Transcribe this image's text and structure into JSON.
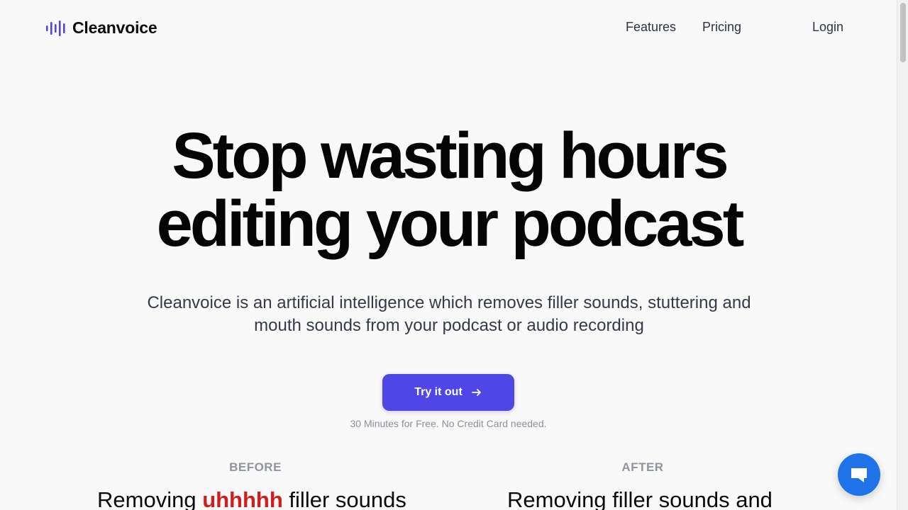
{
  "header": {
    "logo_text": "Cleanvoice",
    "nav": {
      "features": "Features",
      "pricing": "Pricing",
      "login": "Login"
    }
  },
  "hero": {
    "headline_line1": "Stop wasting hours",
    "headline_line2": "editing your podcast",
    "subtext": "Cleanvoice is an artificial intelligence which removes filler sounds, stuttering and mouth sounds from your podcast or audio recording",
    "cta_label": "Try it out",
    "cta_note": "30 Minutes for Free. No Credit Card needed."
  },
  "comparison": {
    "before_label": "BEFORE",
    "before_prefix": "Removing ",
    "before_filler": "uhhhhh",
    "before_suffix": " filler sounds",
    "after_label": "AFTER",
    "after_text": "Removing filler sounds and"
  },
  "colors": {
    "accent": "#4f46e5",
    "filler": "#d31d1d",
    "chat": "#1f73e8"
  },
  "icons": {
    "logo": "waveform-icon",
    "cta": "arrow-right-icon",
    "chat": "chat-bubble-icon"
  }
}
